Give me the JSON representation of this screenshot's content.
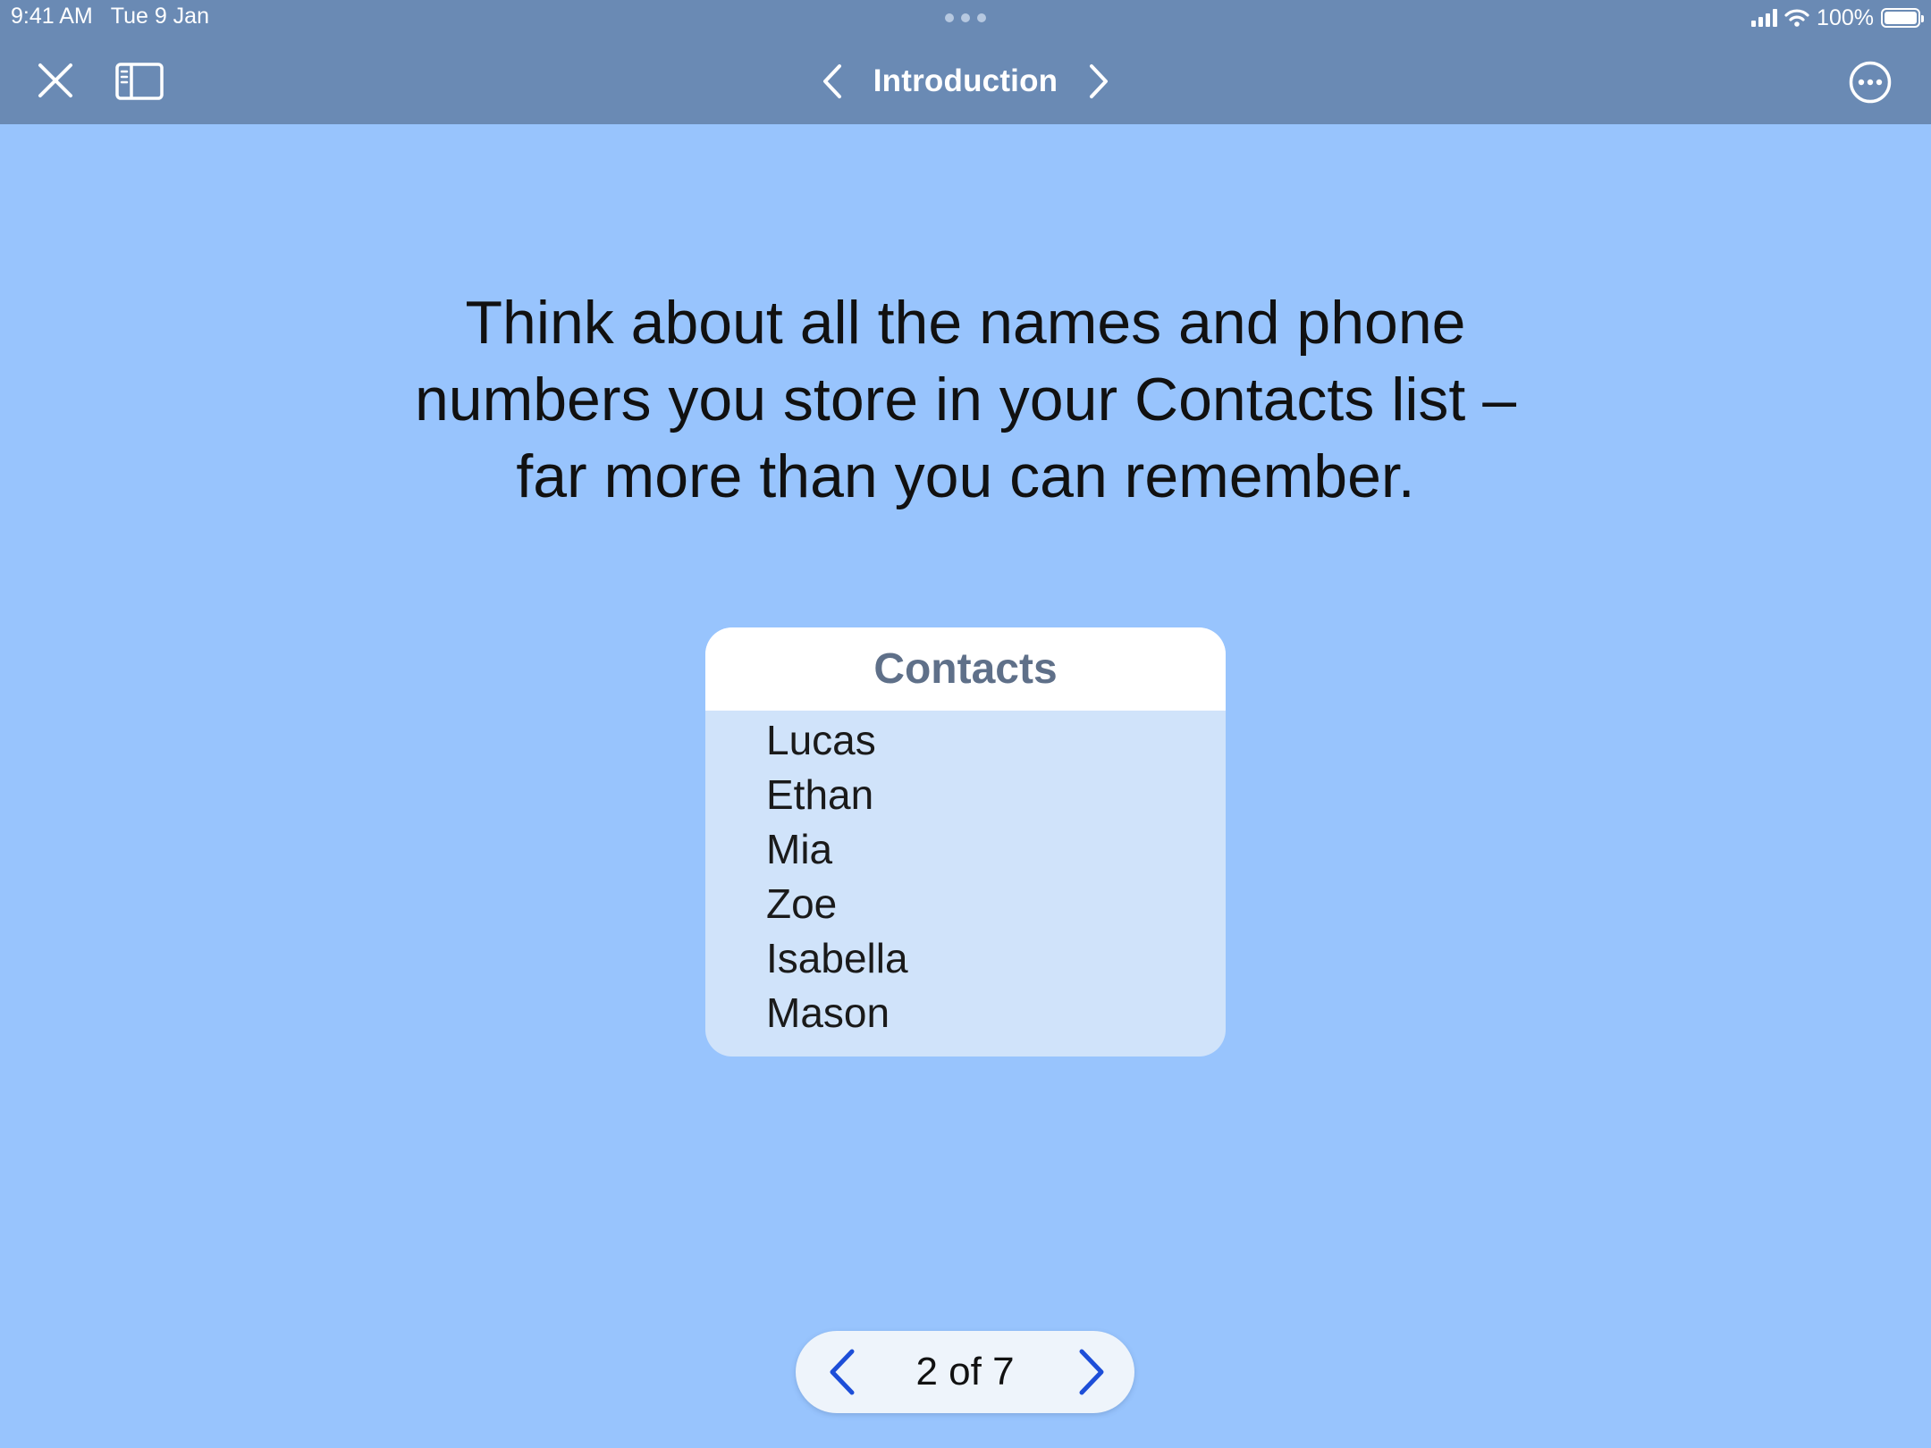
{
  "status_bar": {
    "time": "9:41 AM",
    "date": "Tue 9 Jan",
    "battery": "100%"
  },
  "nav": {
    "title": "Introduction"
  },
  "content": {
    "headline_lines": [
      "Think about all the names and phone",
      "numbers you store in your Contacts list –",
      "far more than you can remember."
    ],
    "contacts_card": {
      "title": "Contacts",
      "names": [
        "Lucas",
        "Ethan",
        "Mia",
        "Zoe",
        "Isabella",
        "Mason"
      ]
    }
  },
  "pager": {
    "label": "2 of 7",
    "current": 2,
    "total": 7
  },
  "colors": {
    "background": "#98c4fd",
    "topbar": "#6a8ab4",
    "card_header_text": "#5f7089",
    "pager_arrow": "#1d4ed8"
  }
}
